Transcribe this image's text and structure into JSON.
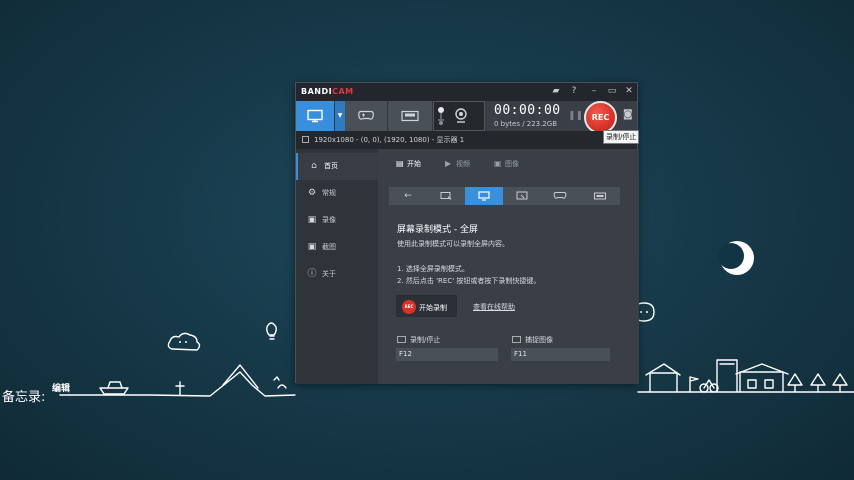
{
  "app": {
    "logo_main": "BANDI",
    "logo_accent": "CAM",
    "timer": "00:00:00",
    "size_info": "0 bytes / 223.2GB",
    "rec_label": "REC",
    "tooltip": "录制/停止",
    "area_text": "1920x1080 - (0, 0), (1920, 1080) - 显示器 1"
  },
  "titlebar_icons": [
    {
      "name": "folder-icon",
      "glyph": "▰"
    },
    {
      "name": "help-icon",
      "glyph": "?"
    },
    {
      "name": "minimize-icon",
      "glyph": "–"
    },
    {
      "name": "restore-icon",
      "glyph": "▭"
    },
    {
      "name": "close-icon",
      "glyph": "✕"
    }
  ],
  "sidebar": {
    "items": [
      {
        "label": "首页",
        "icon": "home-icon",
        "glyph": "⌂"
      },
      {
        "label": "常规",
        "icon": "gear-icon",
        "glyph": "⚙"
      },
      {
        "label": "录像",
        "icon": "video-icon",
        "glyph": "▣"
      },
      {
        "label": "截图",
        "icon": "image-icon",
        "glyph": "▣"
      },
      {
        "label": "关于",
        "icon": "info-icon",
        "glyph": "ⓘ"
      }
    ]
  },
  "subtabs": [
    {
      "label": "开始",
      "icon": "start-icon",
      "glyph": "▤"
    },
    {
      "label": "视频",
      "icon": "video-icon",
      "glyph": "▶"
    },
    {
      "label": "图像",
      "icon": "image-icon",
      "glyph": "▣"
    }
  ],
  "content": {
    "title": "屏幕录制模式 - 全屏",
    "description": "使用此录制模式可以录制全屏内容。",
    "step1": "1. 选择全屏录制模式。",
    "step2": "2. 然后点击 'REC' 按钮或者按下录制快捷键。",
    "start_button": "开始录制",
    "start_button_dot": "REC",
    "help_link": "查看在线帮助",
    "hotkey_record_label": "录制/停止",
    "hotkey_record_value": "F12",
    "hotkey_capture_label": "捕捉图像",
    "hotkey_capture_value": "F11"
  },
  "background": {
    "scribble_text": "备忘录:",
    "scribble_text2": "编辑"
  },
  "colors": {
    "accent": "#3a8fdc",
    "rec_red": "#d8322a",
    "window_bg": "#2b2f36"
  }
}
